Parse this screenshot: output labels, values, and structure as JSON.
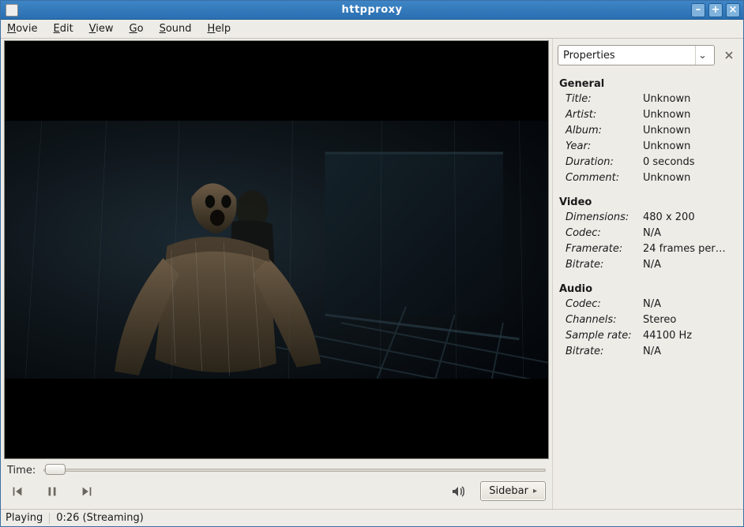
{
  "window": {
    "title": "httpproxy"
  },
  "menu": {
    "movie": "Movie",
    "edit": "Edit",
    "view": "View",
    "go": "Go",
    "sound": "Sound",
    "help": "Help"
  },
  "time": {
    "label": "Time:"
  },
  "controls": {
    "sidebar_label": "Sidebar"
  },
  "sidebar": {
    "selector": "Properties",
    "sections": {
      "general": {
        "heading": "General",
        "title_k": "Title:",
        "title_v": "Unknown",
        "artist_k": "Artist:",
        "artist_v": "Unknown",
        "album_k": "Album:",
        "album_v": "Unknown",
        "year_k": "Year:",
        "year_v": "Unknown",
        "duration_k": "Duration:",
        "duration_v": "0 seconds",
        "comment_k": "Comment:",
        "comment_v": "Unknown"
      },
      "video": {
        "heading": "Video",
        "dimensions_k": "Dimensions:",
        "dimensions_v": "480 x 200",
        "codec_k": "Codec:",
        "codec_v": "N/A",
        "framerate_k": "Framerate:",
        "framerate_v": "24 frames per…",
        "bitrate_k": "Bitrate:",
        "bitrate_v": "N/A"
      },
      "audio": {
        "heading": "Audio",
        "codec_k": "Codec:",
        "codec_v": "N/A",
        "channels_k": "Channels:",
        "channels_v": "Stereo",
        "samplerate_k": "Sample rate:",
        "samplerate_v": "44100 Hz",
        "bitrate_k": "Bitrate:",
        "bitrate_v": "N/A"
      }
    }
  },
  "status": {
    "state": "Playing",
    "time": "0:26 (Streaming)"
  }
}
